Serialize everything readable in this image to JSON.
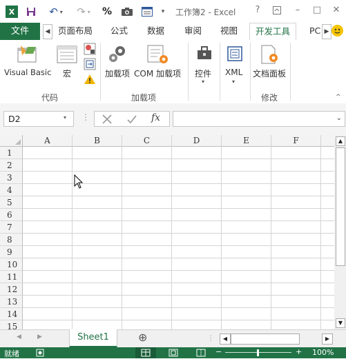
{
  "window": {
    "title": "工作簿2 - Excel",
    "help": "?",
    "minimize": "–",
    "maximize": "□",
    "close": "✕"
  },
  "quick_access": {
    "app_icon_label": "X",
    "undo": "↶",
    "redo": "↷",
    "percent": "%"
  },
  "tabs": {
    "file": "文件",
    "items": [
      "页面布局",
      "公式",
      "数据",
      "审阅",
      "视图",
      "开发工具",
      "PC"
    ],
    "active": "开发工具"
  },
  "ribbon": {
    "visual_basic": "Visual Basic",
    "macro": "宏",
    "addins": "加载项",
    "com_addins": "COM 加载项",
    "controls": "控件",
    "xml": "XML",
    "doc_panel": "文档面板",
    "groups": {
      "code": "代码",
      "addins": "加载项",
      "modify": "修改"
    }
  },
  "formula_bar": {
    "name_box": "D2",
    "formula_value": "",
    "fx": "fx"
  },
  "grid": {
    "columns": [
      "A",
      "B",
      "C",
      "D",
      "E",
      "F"
    ],
    "rows": [
      "1",
      "2",
      "3",
      "4",
      "5",
      "6",
      "7",
      "8",
      "9",
      "10",
      "11",
      "12",
      "13",
      "14",
      "15"
    ]
  },
  "sheets": {
    "tabs": [
      "Sheet1"
    ],
    "active": "Sheet1",
    "add": "⊕"
  },
  "status": {
    "ready": "就绪",
    "zoom": "100%"
  },
  "colors": {
    "accent": "#217346"
  }
}
